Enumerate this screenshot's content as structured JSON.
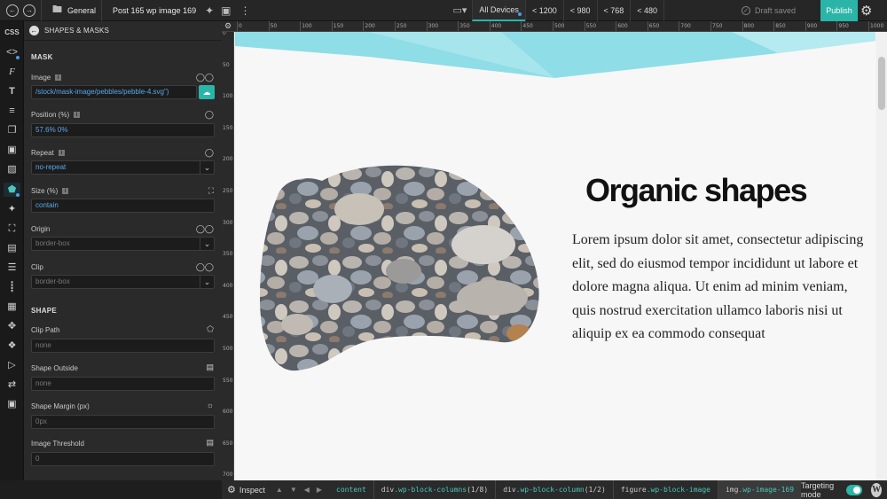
{
  "topbar": {
    "page_label": "General",
    "post_title": "Post 165 wp image 169",
    "device_tabs": [
      "All Devices",
      "< 1200",
      "< 980",
      "< 768",
      "< 480"
    ],
    "status": "Draft saved",
    "publish_label": "Publish"
  },
  "iconbar": {
    "css_label": "CSS"
  },
  "panel": {
    "title": "SHAPES & MASKS",
    "mask_section": "MASK",
    "image_label": "Image",
    "image_value": "/stock/mask-image/pebbles/pebble-4.svg\")",
    "position_label": "Position (%)",
    "position_value": "57.6% 0%",
    "repeat_label": "Repeat",
    "repeat_value": "no-repeat",
    "size_label": "Size (%)",
    "size_value": "contain",
    "origin_label": "Origin",
    "origin_value": "border-box",
    "clip_label": "Clip",
    "clip_value": "border-box",
    "shape_section": "SHAPE",
    "clip_path_label": "Clip Path",
    "clip_path_value": "none",
    "shape_outside_label": "Shape Outside",
    "shape_outside_value": "none",
    "shape_margin_label": "Shape Margin (px)",
    "shape_margin_value": "0px",
    "threshold_label": "Image Threshold",
    "threshold_value": "0"
  },
  "rulers": {
    "top": [
      "0",
      "50",
      "100",
      "150",
      "200",
      "250",
      "300",
      "350",
      "400",
      "450",
      "500",
      "550",
      "600",
      "650",
      "700",
      "750",
      "800",
      "850",
      "900",
      "950",
      "1000"
    ],
    "left": [
      "0",
      "50",
      "100",
      "150",
      "200",
      "250",
      "300",
      "350",
      "400",
      "450",
      "500",
      "550",
      "600",
      "650",
      "700"
    ]
  },
  "content": {
    "heading": "Organic shapes",
    "paragraph": "Lorem ipsum dolor sit amet, consectetur adipiscing elit, sed do eiusmod tempor incididunt ut labore et dolore magna aliqua. Ut enim ad minim veniam, quis nostrud exercitation ullamco laboris nisi ut aliquip ex ea commodo consequat"
  },
  "bottombar": {
    "inspect_label": "Inspect",
    "breadcrumbs": [
      {
        "tag": "",
        "cls": "content",
        "suffix": ""
      },
      {
        "tag": "div",
        "cls": ".wp-block-columns",
        "suffix": " (1/8)"
      },
      {
        "tag": "div",
        "cls": ".wp-block-column",
        "suffix": " (1/2)"
      },
      {
        "tag": "figure",
        "cls": ".wp-block-image",
        "suffix": ""
      },
      {
        "tag": "img",
        "cls": ".wp-image-169",
        "suffix": ""
      }
    ],
    "targeting_label": "Targeting mode"
  },
  "colors": {
    "accent": "#2bb5a8",
    "panel_bg": "#2a2a2a",
    "banner": "#8fdde6"
  }
}
